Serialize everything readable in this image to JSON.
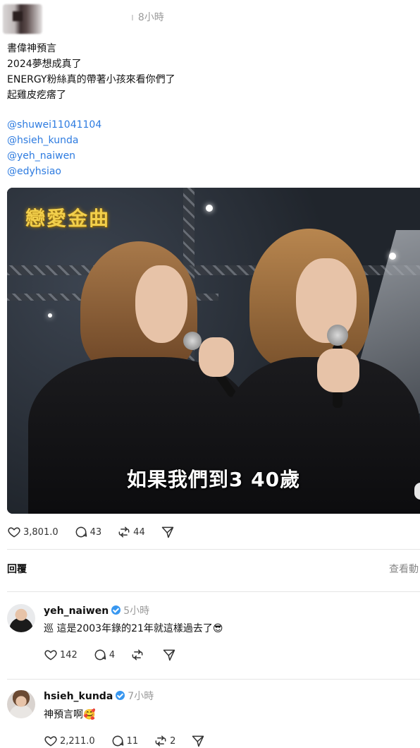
{
  "post": {
    "time": "8小時",
    "lines": [
      "書偉神預言",
      "2024夢想成真了",
      "ENERGY粉絲真的帶著小孩來看你們了",
      "起雞皮疙瘩了"
    ],
    "mentions": [
      "@shuwei11041104",
      "@hsieh_kunda",
      "@yeh_naiwen",
      "@edyhsiao"
    ],
    "video": {
      "logo_text": "戀愛金曲",
      "subtitle": "如果我們到3  40歲"
    },
    "stats": {
      "likes": "3,801.0",
      "comments": "43",
      "reposts": "44"
    }
  },
  "replies_header": {
    "title": "回覆",
    "view_activity": "查看動"
  },
  "comments": [
    {
      "username": "yeh_naiwen",
      "time": "5小時",
      "text": "巡 這是2003年錄的21年就這樣過去了😎",
      "likes": "142",
      "comments": "4",
      "reposts": ""
    },
    {
      "username": "hsieh_kunda",
      "time": "7小時",
      "text": "神預言啊🥰",
      "likes": "2,211.0",
      "comments": "11",
      "reposts": "2"
    }
  ],
  "colors": {
    "mention": "#2d7be0",
    "verified": "#3897f0",
    "subtitle": "#ffffff"
  },
  "icons": [
    "heart-icon",
    "comment-icon",
    "repost-icon",
    "share-icon",
    "verified-badge-icon"
  ]
}
